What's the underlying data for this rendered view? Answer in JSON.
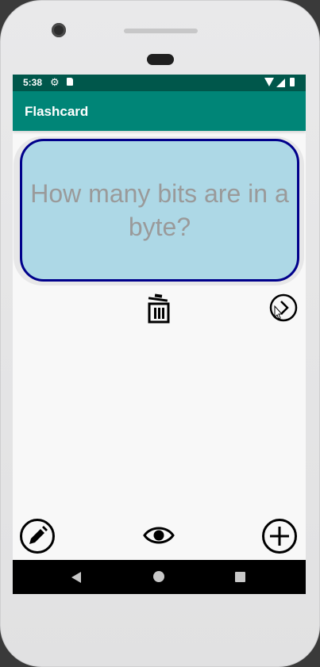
{
  "status_bar": {
    "time": "5:38",
    "settings_icon": "gear-icon",
    "sd_card_icon": "sd-card-icon",
    "wifi_icon": "wifi-icon",
    "signal_icon": "signal-icon",
    "battery_icon": "battery-icon"
  },
  "app_bar": {
    "title": "Flashcard"
  },
  "flashcard": {
    "question": "How many bits are in a byte?"
  },
  "actions": {
    "delete_icon": "trash-icon",
    "next_icon": "chevron-right-circle-icon",
    "edit_icon": "pencil-circle-icon",
    "toggle_answer_icon": "eye-icon",
    "add_icon": "plus-circle-icon"
  },
  "nav_bar": {
    "back_icon": "back-triangle-icon",
    "home_icon": "home-circle-icon",
    "recents_icon": "recents-square-icon"
  },
  "colors": {
    "status_bar": "#00574b",
    "app_bar": "#008577",
    "card_background": "#add8e6",
    "card_border": "#00008b",
    "question_text": "#9a9a9a"
  }
}
